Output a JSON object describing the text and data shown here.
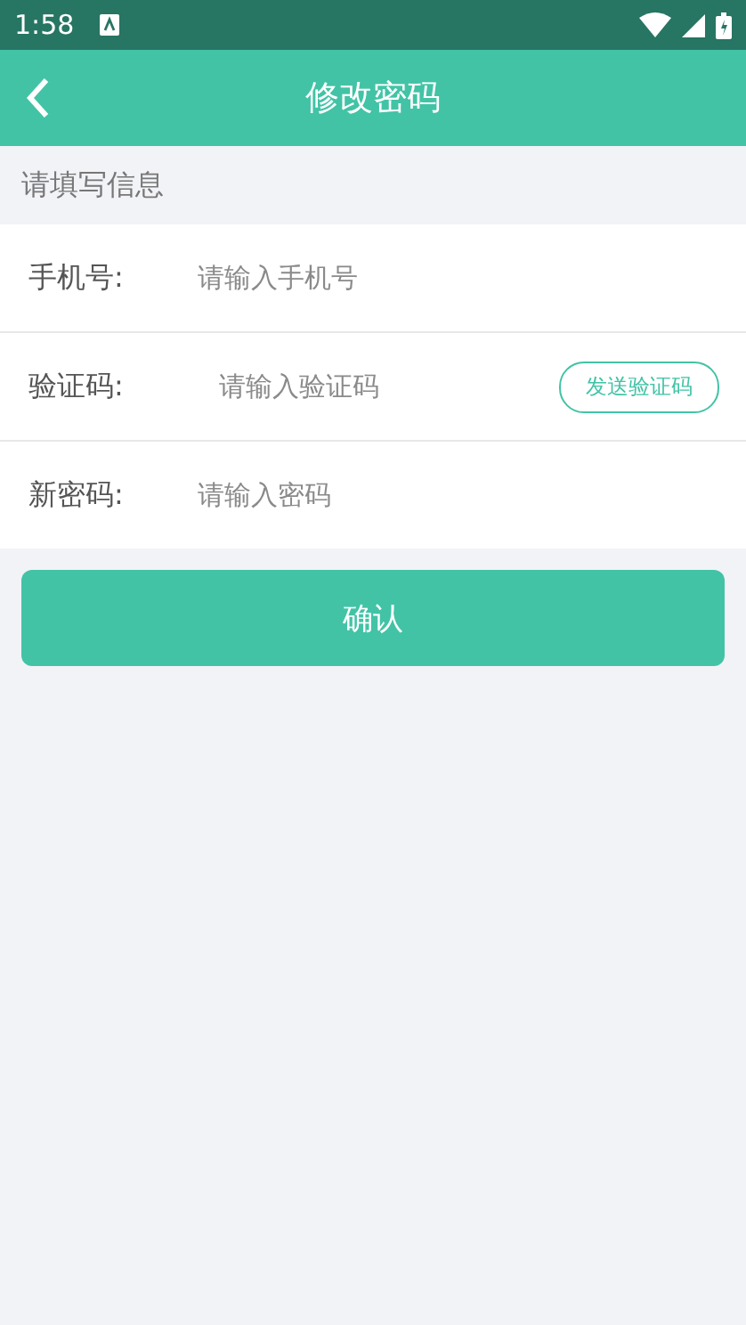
{
  "status_bar": {
    "time": "1:58"
  },
  "header": {
    "title": "修改密码"
  },
  "section_label": "请填写信息",
  "fields": [
    {
      "kind": "phone",
      "label": "手机号:",
      "placeholder": "请输入手机号"
    },
    {
      "kind": "code",
      "label": "验证码:",
      "placeholder": "请输入验证码",
      "action": "发送验证码"
    },
    {
      "kind": "password",
      "label": "新密码:",
      "placeholder": "请输入密码"
    }
  ],
  "confirm_button": "确认"
}
